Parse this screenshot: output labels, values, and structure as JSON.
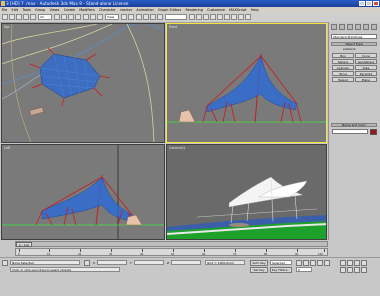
{
  "titlebar": {
    "title": "3 [HD] 7 .max - Autodesk 3ds Max 9 - Stand-alone License"
  },
  "menu": {
    "items": [
      "File",
      "Edit",
      "Tools",
      "Group",
      "Views",
      "Create",
      "Modifiers",
      "Character",
      "reactor",
      "Animation",
      "Graph Editors",
      "Rendering",
      "Customize",
      "MAXScript",
      "Help"
    ]
  },
  "toolbar": {
    "select_all": "All",
    "ref_coord": "View",
    "named_sel": ""
  },
  "viewports": {
    "top": {
      "label": "Top"
    },
    "front": {
      "label": "Front"
    },
    "left": {
      "label": "Left"
    },
    "perspective": {
      "label": "Camera01"
    }
  },
  "command_panel": {
    "dropdown": "Standard Primitives",
    "object_type_header": "Object Type",
    "autogrid": "AutoGrid",
    "buttons": [
      "Box",
      "Cone",
      "Sphere",
      "GeoSphere",
      "Cylinder",
      "Tube",
      "Torus",
      "Pyramid",
      "Teapot",
      "Plane"
    ],
    "name_color_header": "Name and Color",
    "name_value": ""
  },
  "timeline": {
    "slider_label": "0 / 100",
    "ticks": [
      "0",
      "10",
      "20",
      "30",
      "40",
      "50",
      "60",
      "70",
      "80",
      "90",
      "100"
    ]
  },
  "status": {
    "selection": "None Selected",
    "prompt": "Click or click-and-drag to select objects",
    "x_label": "X",
    "y_label": "Y",
    "z_label": "Z",
    "grid": "Grid = 1000.0mm",
    "auto_key": "Auto Key",
    "set_key": "Set Key",
    "selected": "Selected",
    "key_filters": "Key Filters...",
    "frame": "0"
  },
  "colors": {
    "accent": "#f5e23a",
    "mesh": "#2a6ad8",
    "mast": "#cc1a1a",
    "swatch": "#9a1422"
  }
}
